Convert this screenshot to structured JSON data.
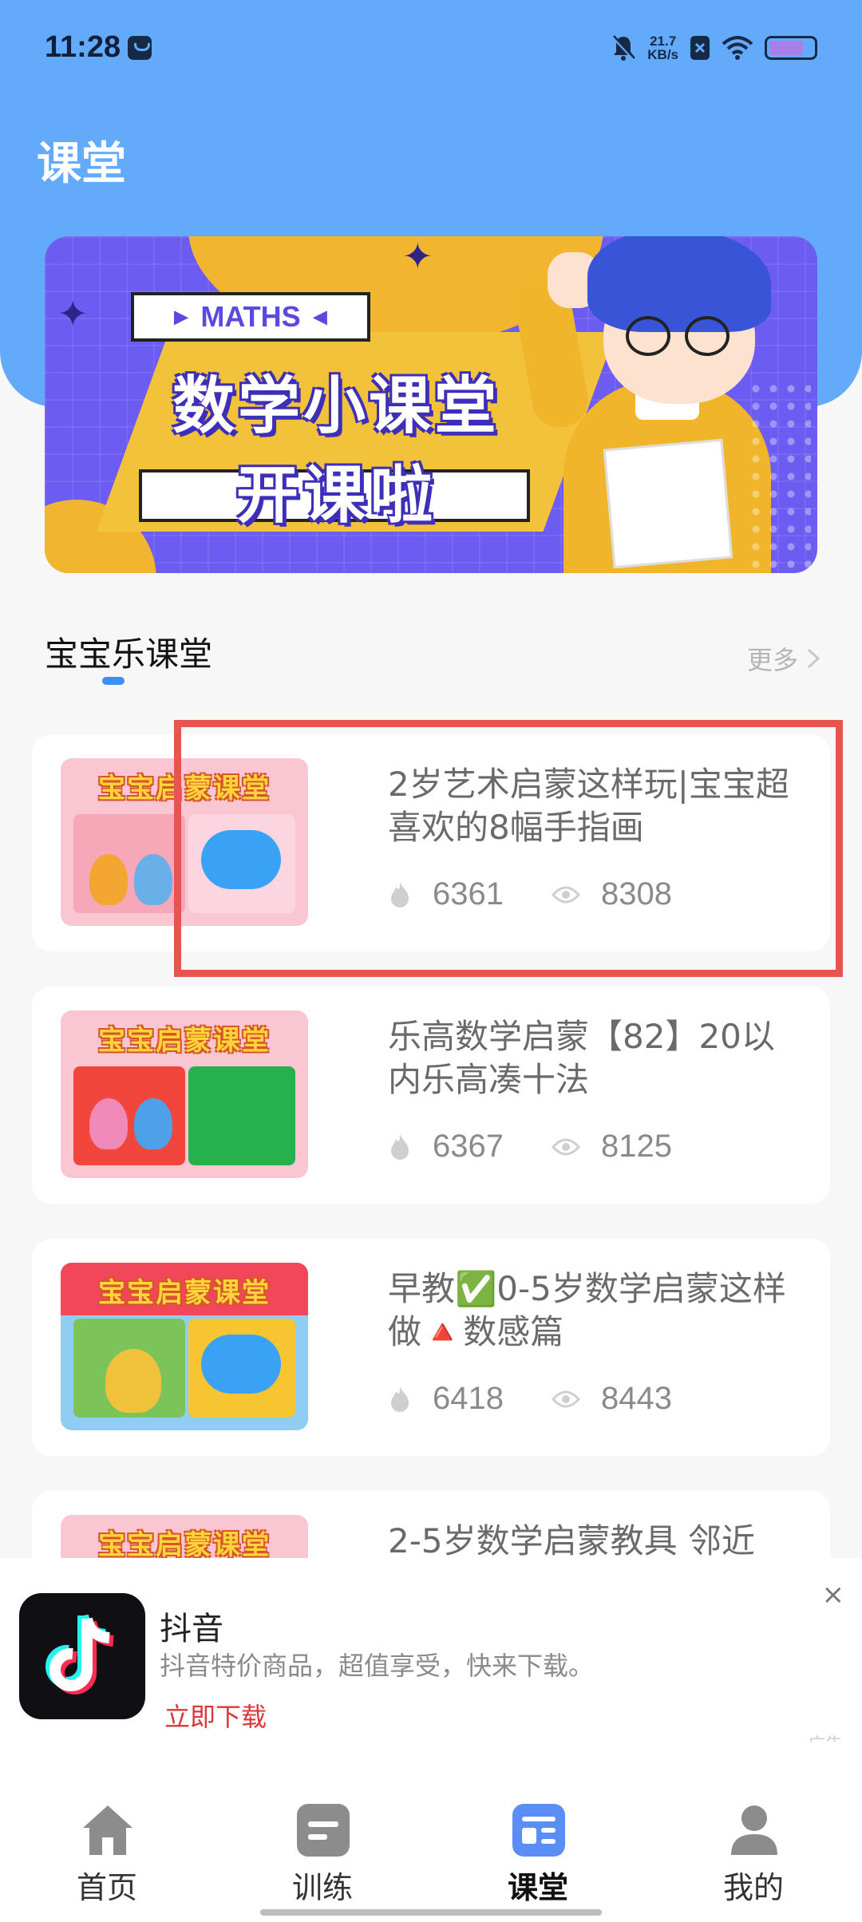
{
  "status_bar": {
    "time": "11:28",
    "net_speed_value": "21.7",
    "net_speed_unit": "KB/s"
  },
  "page": {
    "title": "课堂"
  },
  "banner": {
    "tag": "MATHS",
    "title_line1": "数学小课堂",
    "title_line2": "开课啦"
  },
  "section": {
    "title": "宝宝乐课堂",
    "more_label": "更多"
  },
  "courses": [
    {
      "title": "2岁艺术启蒙这样玩|宝宝超喜欢的8幅手指画",
      "likes": "6361",
      "views": "8308",
      "thumb_label": "宝宝启蒙课堂"
    },
    {
      "title": "乐高数学启蒙【82】20以内乐高凑十法",
      "likes": "6367",
      "views": "8125",
      "thumb_label": "宝宝启蒙课堂"
    },
    {
      "title": "早教✅0-5岁数学启蒙这样做🔺数感篇",
      "likes": "6418",
      "views": "8443",
      "thumb_label": "宝宝启蒙课堂"
    },
    {
      "title": "2-5岁数学启蒙教具 邻近",
      "thumb_label": "宝宝启蒙课堂"
    }
  ],
  "ad": {
    "app_name": "抖音",
    "description": "抖音特价商品，超值享受，快来下载。",
    "cta": "立即下载",
    "close": "×",
    "label": "广告"
  },
  "bottom_nav": [
    {
      "label": "首页",
      "icon": "home-icon"
    },
    {
      "label": "训练",
      "icon": "training-icon"
    },
    {
      "label": "课堂",
      "icon": "classroom-icon",
      "active": true
    },
    {
      "label": "我的",
      "icon": "profile-icon"
    }
  ],
  "colors": {
    "header": "#64aafa",
    "accent": "#3d8ef5",
    "highlight": "#e85550",
    "cta": "#d8383a",
    "nav_active": "#5a8ef5"
  }
}
